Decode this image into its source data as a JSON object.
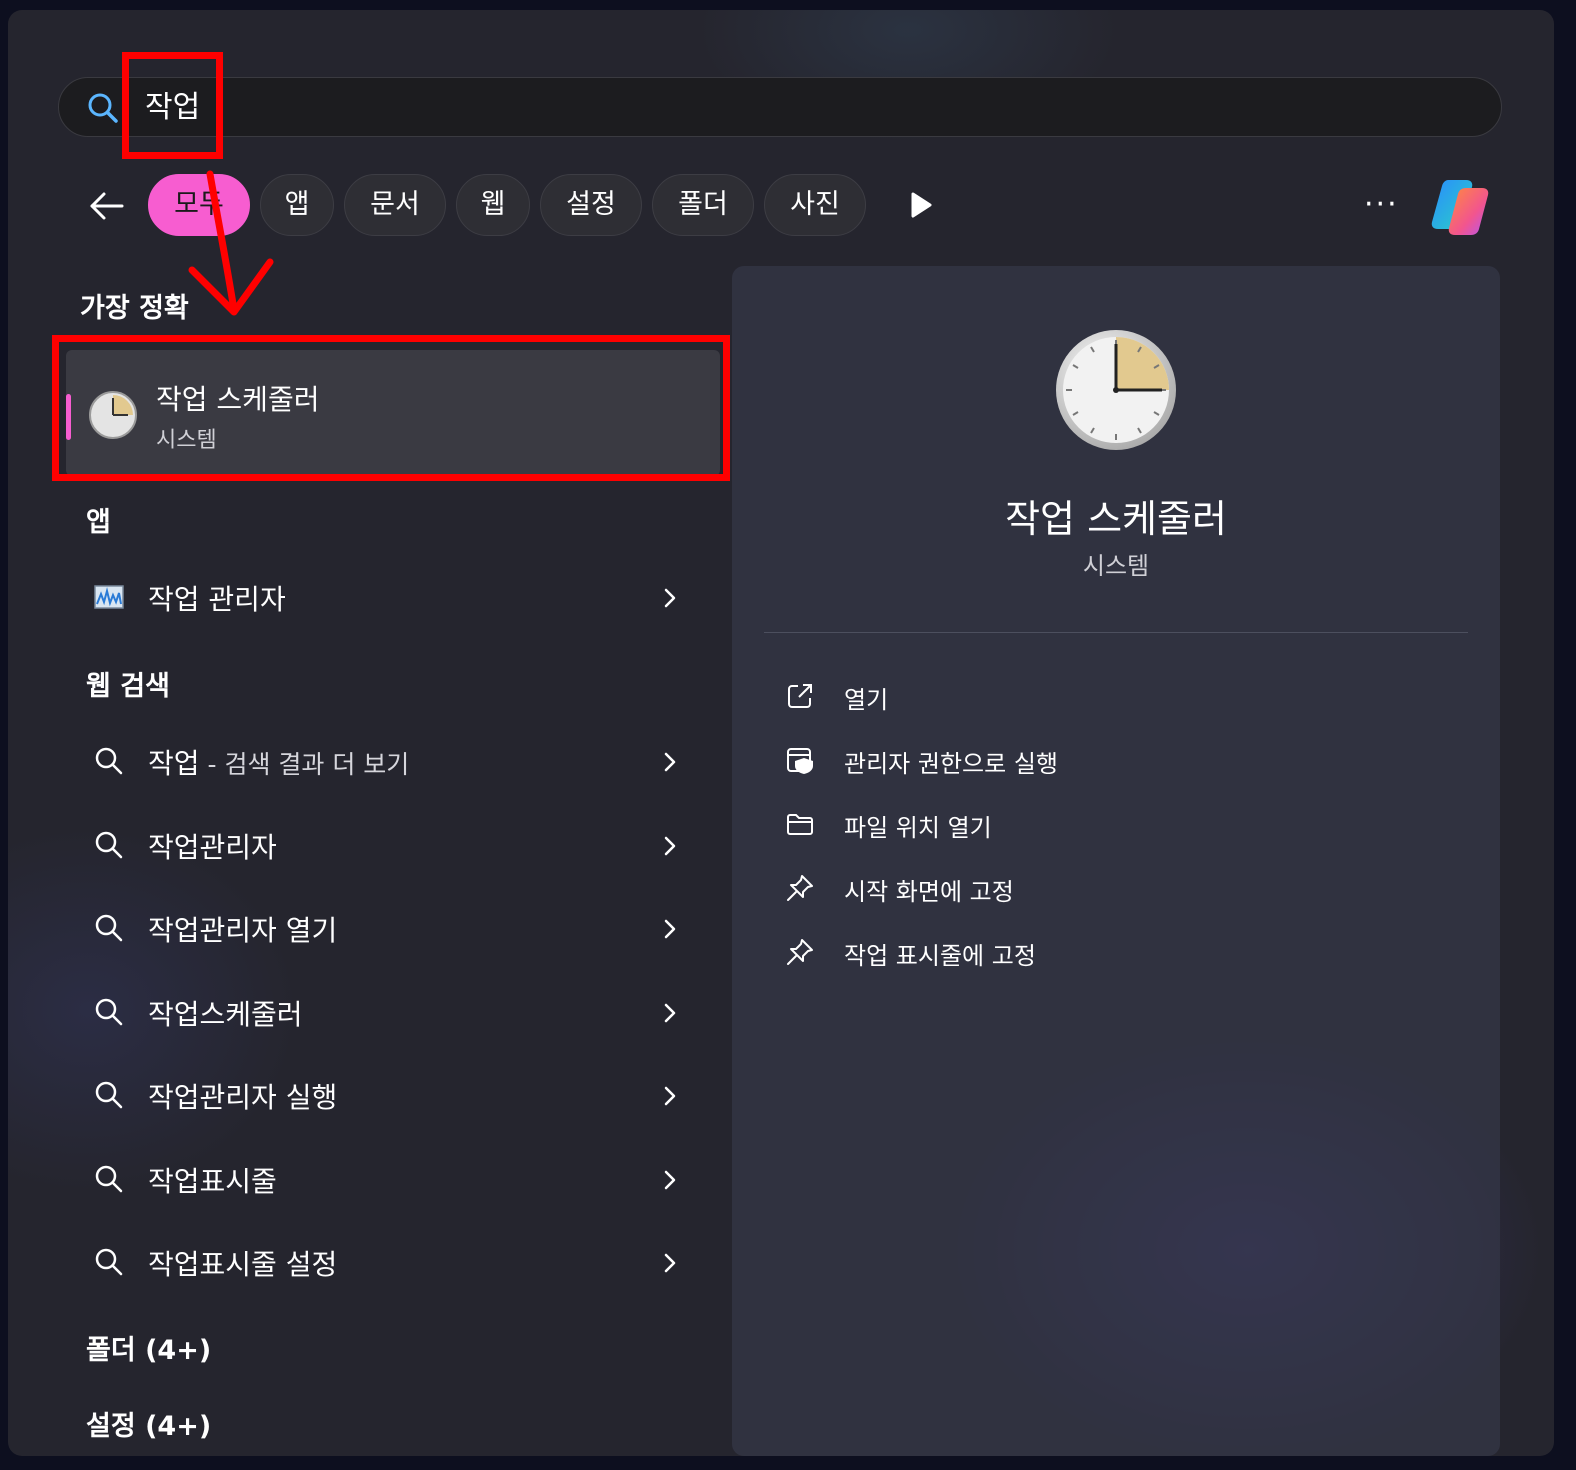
{
  "search": {
    "query": "작업"
  },
  "filters": [
    {
      "label": "모두",
      "active": true
    },
    {
      "label": "앱"
    },
    {
      "label": "문서"
    },
    {
      "label": "웹"
    },
    {
      "label": "설정"
    },
    {
      "label": "폴더"
    },
    {
      "label": "사진"
    }
  ],
  "more_label": "···",
  "sections": {
    "best_match": "가장 정확",
    "apps": "앱",
    "web_search": "웹 검색",
    "folders": "폴더 (4+)",
    "settings": "설정 (4+)"
  },
  "best_match": {
    "title": "작업 스케줄러",
    "subtitle": "시스템",
    "icon": "clock-icon"
  },
  "apps": [
    {
      "label": "작업 관리자",
      "icon": "task-manager-icon"
    }
  ],
  "web_results": [
    {
      "label": "작업",
      "suffix": " - 검색 결과 더 보기"
    },
    {
      "label": "작업관리자",
      "suffix": ""
    },
    {
      "label": "작업관리자 열기",
      "suffix": ""
    },
    {
      "label": "작업스케줄러",
      "suffix": ""
    },
    {
      "label": "작업관리자 실행",
      "suffix": ""
    },
    {
      "label": "작업표시줄",
      "suffix": ""
    },
    {
      "label": "작업표시줄 설정",
      "suffix": ""
    }
  ],
  "preview": {
    "title": "작업 스케줄러",
    "subtitle": "시스템",
    "actions": [
      {
        "label": "열기",
        "icon": "open-external-icon"
      },
      {
        "label": "관리자 권한으로 실행",
        "icon": "run-as-admin-icon"
      },
      {
        "label": "파일 위치 열기",
        "icon": "folder-icon"
      },
      {
        "label": "시작 화면에 고정",
        "icon": "pin-icon"
      },
      {
        "label": "작업 표시줄에 고정",
        "icon": "pin-icon"
      }
    ]
  },
  "colors": {
    "accent": "#f75dd0",
    "annotation": "#ff0000",
    "panel": "#25252e"
  }
}
